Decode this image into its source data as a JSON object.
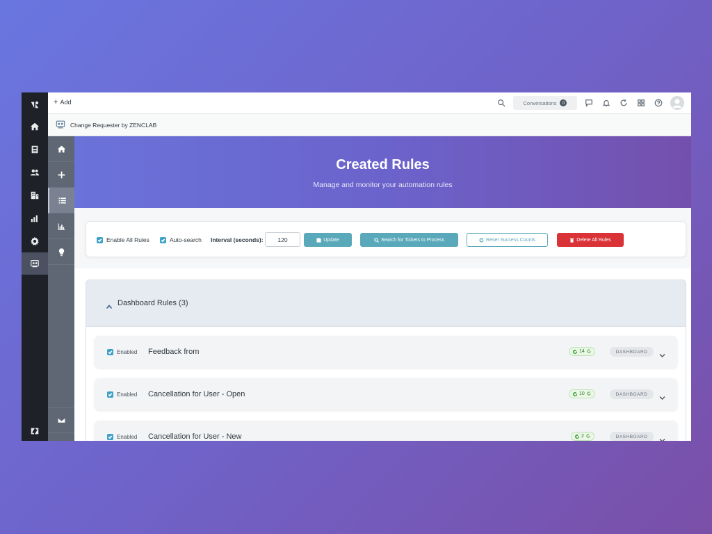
{
  "topbar": {
    "add_label": "Add",
    "conversations_label": "Conversations",
    "conversations_count": "0",
    "icons": [
      "search-icon",
      "chat-icon",
      "bell-icon",
      "refresh-icon",
      "apps-grid-icon",
      "help-icon"
    ]
  },
  "rail": {
    "icons": [
      "zendesk-logo-icon",
      "home-icon",
      "views-icon",
      "customers-icon",
      "organizations-icon",
      "reporting-icon",
      "admin-gear-icon",
      "app-icon",
      "zendesk-footer-logo-icon"
    ]
  },
  "app": {
    "title": "Change Requester by ZENCLAB"
  },
  "app_sidebar": {
    "icons": [
      "home-icon",
      "plus-icon",
      "list-icon",
      "chart-icon",
      "lightbulb-icon",
      "mail-icon"
    ]
  },
  "hero": {
    "title": "Created Rules",
    "subtitle": "Manage and monitor your automation rules"
  },
  "controls": {
    "enable_all_label": "Enable All Rules",
    "auto_search_label": "Auto-search",
    "interval_label": "Interval (seconds):",
    "interval_value": "120",
    "update_label": "Update",
    "search_label": "Search for Tickets to Process",
    "reset_label": "Reset Success Counts",
    "delete_label": "Delete All Rules"
  },
  "group": {
    "title": "Dashboard Rules (3)"
  },
  "rules": [
    {
      "enabled_label": "Enabled",
      "name": "Feedback from",
      "count": "14",
      "type": "DASHBOARD"
    },
    {
      "enabled_label": "Enabled",
      "name": "Cancellation for User - Open",
      "count": "10",
      "type": "DASHBOARD"
    },
    {
      "enabled_label": "Enabled",
      "name": "Cancellation for User - New",
      "count": "2",
      "type": "DASHBOARD"
    }
  ],
  "colors": {
    "accent_teal": "#5aa9bb",
    "danger_red": "#d93237",
    "checkbox_blue": "#3ea1c7",
    "hero_start": "#6a73d9",
    "hero_end": "#7450ad"
  }
}
